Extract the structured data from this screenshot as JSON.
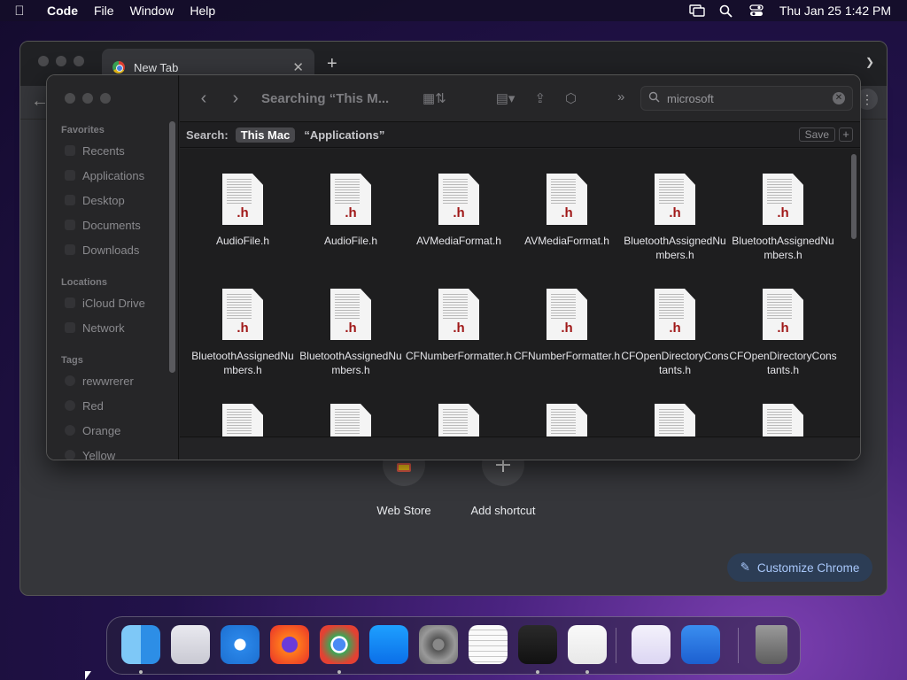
{
  "menubar": {
    "app_name": "Code",
    "menus": [
      "File",
      "Window",
      "Help"
    ],
    "clock": "Thu Jan 25  1:42 PM"
  },
  "chrome": {
    "tab_title": "New Tab",
    "shortcuts": [
      {
        "label": "Web Store"
      },
      {
        "label": "Add shortcut"
      }
    ],
    "customize_label": "Customize Chrome"
  },
  "finder": {
    "title": "Searching “This M...",
    "search_value": "microsoft",
    "sidebar": {
      "favorites_header": "Favorites",
      "favorites": [
        "Recents",
        "Applications",
        "Desktop",
        "Documents",
        "Downloads"
      ],
      "locations_header": "Locations",
      "locations": [
        "iCloud Drive",
        "Network"
      ],
      "tags_header": "Tags",
      "tags": [
        "rewwrerer",
        "Red",
        "Orange",
        "Yellow"
      ]
    },
    "scope": {
      "label": "Search:",
      "this_mac": "This Mac",
      "applications": "“Applications”",
      "save": "Save",
      "plus": "+"
    },
    "file_ext": ".h",
    "files": [
      "AudioFile.h",
      "AudioFile.h",
      "AVMediaFormat.h",
      "AVMediaFormat.h",
      "BluetoothAssignedNumbers.h",
      "BluetoothAssignedNumbers.h",
      "BluetoothAssignedNumbers.h",
      "BluetoothAssignedNumbers.h",
      "CFNumberFormatter.h",
      "CFNumberFormatter.h",
      "CFOpenDirectoryConstants.h",
      "CFOpenDirectoryConstants.h",
      "",
      "",
      "",
      "",
      "",
      ""
    ]
  },
  "dock": {
    "apps": [
      "Finder",
      "Launchpad",
      "Safari",
      "Firefox",
      "Chrome",
      "App Store",
      "System Settings",
      "TextEdit",
      "Terminal",
      "Visual Studio Code",
      "Visual Studio",
      "Weather",
      "Trash"
    ]
  },
  "colors": {
    "accent_blue": "#a8c7fa",
    "file_ext_red": "#a01818"
  }
}
